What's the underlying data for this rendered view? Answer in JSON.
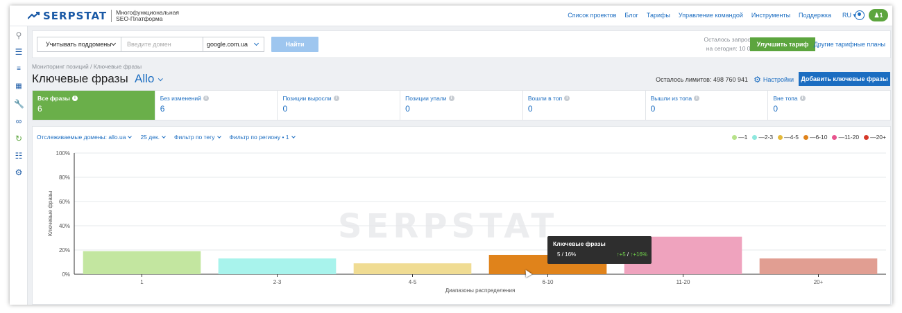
{
  "header": {
    "logo": "SERPSTAT",
    "tagline_1": "Многофункциональная",
    "tagline_2": "SEO-Платформа",
    "nav": [
      "Список проектов",
      "Блог",
      "Тарифы",
      "Управление командой",
      "Инструменты",
      "Поддержка"
    ],
    "lang": "RU ▾",
    "team_badge": "1"
  },
  "sidebar": {
    "icons": [
      "search-icon",
      "menu-icon",
      "list-icon",
      "keywords-icon",
      "wrench-icon",
      "link-icon",
      "rank-tracker-icon",
      "sitemap-icon",
      "gear-icon"
    ]
  },
  "search": {
    "subdomains_select": "Учитывать поддомены",
    "domain_placeholder": "Введите домен",
    "engine": "google.com.ua",
    "find_button": "Найти",
    "quota_line1": "Осталось запросов",
    "quota_line2": "на сегодня: 10 000",
    "upgrade_button": "Улучшить тариф",
    "other_plans": "Другие тарифные планы"
  },
  "page": {
    "breadcrumb": "Мониторинг позиций / Ключевые фразы",
    "title": "Ключевые фразы",
    "project": "Allo",
    "limits": "Осталось лимитов: 498 760 941",
    "settings": "Настройки",
    "add_keywords": "Добавить ключевые фразы"
  },
  "cards": [
    {
      "label": "Все фразы",
      "value": "6",
      "active": true
    },
    {
      "label": "Без изменений",
      "value": "6",
      "active": false
    },
    {
      "label": "Позиции выросли",
      "value": "0",
      "active": false
    },
    {
      "label": "Позиции упали",
      "value": "0",
      "active": false
    },
    {
      "label": "Вошли в топ",
      "value": "0",
      "active": false
    },
    {
      "label": "Вышли из топа",
      "value": "0",
      "active": false
    },
    {
      "label": "Вне топа",
      "value": "0",
      "active": false
    }
  ],
  "filters": [
    "Отслеживаемые домены: allo.ua",
    "25 дек.",
    "Фильтр по тегу",
    "Фильтр по региону • 1"
  ],
  "tooltip": {
    "title": "Ключевые фразы",
    "count": "5 / 16%",
    "changes_a": "↑+5",
    "changes_sep": " / ",
    "changes_b": "↑+16%"
  },
  "chart_data": {
    "type": "bar",
    "watermark": "SERPSTAT",
    "xlabel": "Диапазоны распределения",
    "ylabel": "Ключевые фразы",
    "ylim": [
      0,
      100
    ],
    "yticks": [
      "0%",
      "20%",
      "40%",
      "60%",
      "80%",
      "100%"
    ],
    "grid": true,
    "legend_position": "top-right",
    "categories": [
      "1",
      "2-3",
      "4-5",
      "6-10",
      "11-20",
      "20+"
    ],
    "legend_labels": [
      "—1",
      "—2-3",
      "—4-5",
      "—6-10",
      "—11-20",
      "—20+"
    ],
    "values": [
      19,
      13,
      9,
      16,
      31,
      13
    ],
    "colors": [
      "#c3e6a0",
      "#a8f3ec",
      "#f0dc93",
      "#e0831b",
      "#efa3be",
      "#e19e92"
    ],
    "legend_colors": [
      "#b7e28a",
      "#8ee8de",
      "#e4b93a",
      "#e0831b",
      "#e8548e",
      "#d63a2a"
    ],
    "highlighted_category": "6-10"
  }
}
